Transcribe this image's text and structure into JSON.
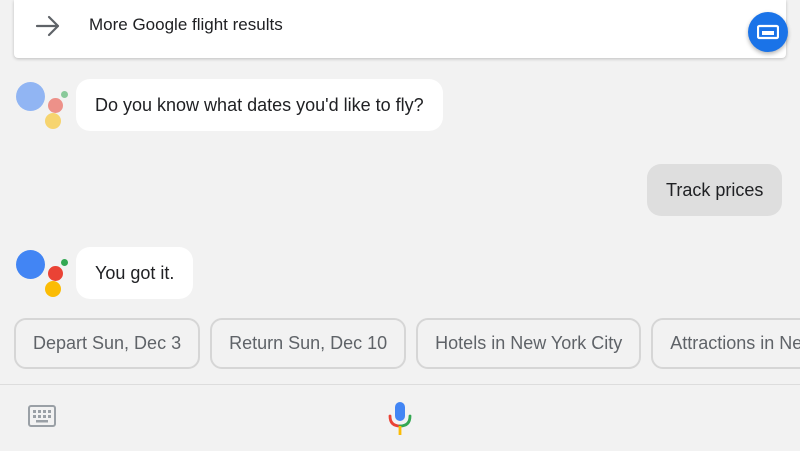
{
  "top_card": {
    "label": "More Google flight results",
    "icon": "arrow-right-icon",
    "action_icon": "cast-icon"
  },
  "conversation": [
    {
      "from": "assistant",
      "text": "Do you know what dates you'd like to fly?"
    },
    {
      "from": "user",
      "text": "Track prices"
    },
    {
      "from": "assistant",
      "text": "You got it."
    }
  ],
  "suggestions": [
    "Depart Sun, Dec 3",
    "Return Sun, Dec 10",
    "Hotels in New York City",
    "Attractions in New York City"
  ],
  "bottom_bar": {
    "left_icon": "keyboard-icon",
    "center_icon": "mic-icon"
  },
  "colors": {
    "google_blue": "#4285f4",
    "google_red": "#ea4335",
    "google_yellow": "#fbbc05",
    "google_green": "#34a853",
    "fab_blue": "#1a73e8",
    "background": "#f2f2f2",
    "user_bubble": "#dedede"
  }
}
